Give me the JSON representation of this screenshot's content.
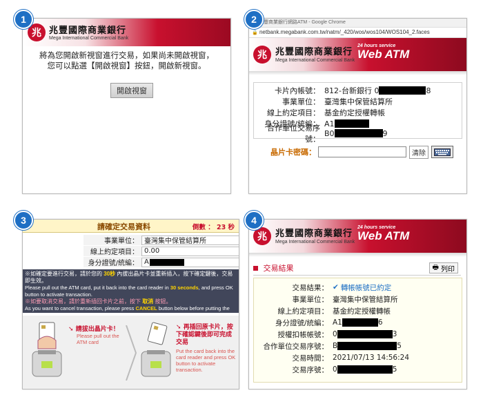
{
  "badges": [
    "1",
    "2",
    "3",
    "4"
  ],
  "bank": {
    "name_cn": "兆豐國際商業銀行",
    "name_en": "Mega International Commercial Bank",
    "logo_glyph": "兆",
    "service_small": "24 hours service",
    "service_big": "Web ATM"
  },
  "panel1": {
    "message_line1": "將為您開啟新視窗進行交易，如果尚未開啟視窗，",
    "message_line2": "您可以點選【開啟視窗】按鈕，開啟新視窗。",
    "open_button": "開啟視窗"
  },
  "panel2": {
    "window_title": "兆豐商業銀行網路ATM - Google Chrome",
    "url": "netbank.megabank.com.tw/natm/_420/wos/wos104/WOS104_2.faces",
    "rows": [
      {
        "label": "卡片內帳號：",
        "value": "812-台新銀行 0",
        "suffix": "8"
      },
      {
        "label": "事業單位：",
        "value": "臺灣集中保管結算所",
        "suffix": ""
      },
      {
        "label": "線上約定項目：",
        "value": "基金約定授權轉帳",
        "suffix": ""
      },
      {
        "label": "身分證號/統編：",
        "value": "A1",
        "suffix": ""
      },
      {
        "label": "合作單位交易序號：",
        "value": "B0",
        "suffix": "9"
      }
    ],
    "pin_label": "晶片卡密碼：",
    "pin_placeholder": "",
    "clear_button": "清除",
    "keyboard_icon": "keyboard-icon"
  },
  "panel3": {
    "title": "請確定交易資料",
    "countdown": "倒數 ： 23 秒",
    "rows": [
      {
        "label": "事業單位：",
        "value": "臺灣集中保管結算所"
      },
      {
        "label": "線上約定項目：",
        "value": "0.00"
      },
      {
        "label": "身分證號/統編：",
        "value": "A"
      }
    ],
    "note1_a": "※如確定要進行交易，請於您的 ",
    "note1_b": "30秒",
    "note1_c": " 內拔出晶片卡並重新插入，按下確定鍵後，交易即生效。",
    "note1_en_a": "Please pull out the ATM card, put it back into the card reader in ",
    "note1_en_b": "30 seconds",
    "note1_en_c": ", and press OK button to activate transaction.",
    "note2_a": "※如要取消交易，請於重新插回卡片之前，按下 ",
    "note2_b": "取消",
    "note2_c": " 按鈕。",
    "note2_en_a": "As you want to cancel transaction, please press ",
    "note2_en_b": "CANCEL",
    "note2_en_c": " button below before putting the ATM card back into the card reader.",
    "step1_cn": "請拔出晶片卡！",
    "step1_en": "Please pull out the ATM card",
    "step2_cn": "再插回原卡片，按下確認鍵後即可完成交易",
    "step2_en": "Put the card back into the card reader and press OK button to activate transaction."
  },
  "panel4": {
    "section_title": "交易結果",
    "print_button": "列印",
    "rows": [
      {
        "label": "交易結果：",
        "value": "轉帳帳號已約定",
        "suffix": ""
      },
      {
        "label": "事業單位：",
        "value": "臺灣集中保管結算所",
        "suffix": ""
      },
      {
        "label": "線上約定項目：",
        "value": "基金約定授權轉帳",
        "suffix": ""
      },
      {
        "label": "身分證號/統編：",
        "value": "A1",
        "suffix": "6"
      },
      {
        "label": "授權扣帳帳號：",
        "value": "0",
        "suffix": "3"
      },
      {
        "label": "合作單位交易序號：",
        "value": "B",
        "suffix": "5"
      },
      {
        "label": "交易時間：",
        "value": "2021/07/13 14:56:24",
        "suffix": ""
      },
      {
        "label": "交易序號：",
        "value": "0",
        "suffix": "5"
      }
    ]
  },
  "colors": {
    "brand_red": "#c8102e",
    "badge_blue": "#1e6fc4",
    "confirm_blue": "#1e6fc4"
  }
}
